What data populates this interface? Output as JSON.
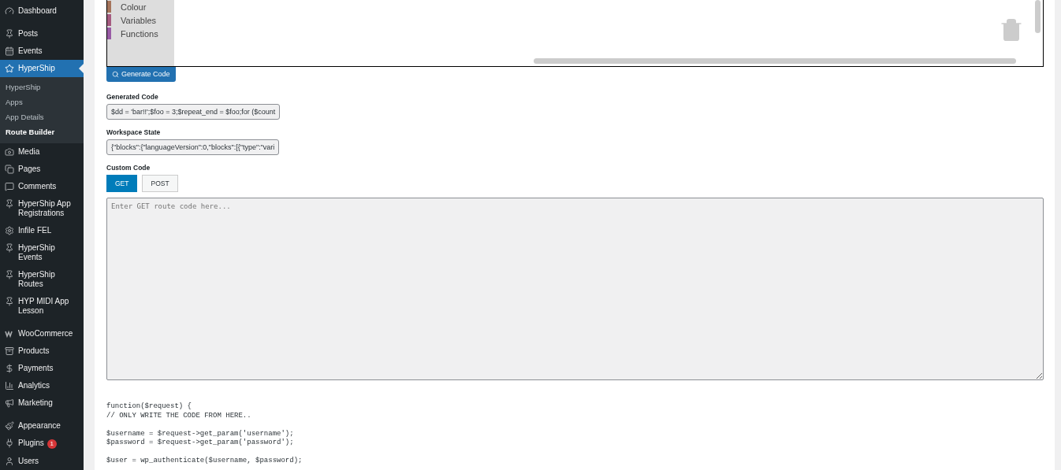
{
  "sidebar": {
    "groups": [
      {
        "items": [
          {
            "label": "Dashboard",
            "selected": false
          }
        ]
      },
      {
        "items": [
          {
            "label": "Posts",
            "selected": false
          },
          {
            "label": "Events",
            "selected": false
          },
          {
            "label": "HyperShip",
            "selected": true,
            "children": [
              {
                "label": "HyperShip",
                "selected": false
              },
              {
                "label": "Apps",
                "selected": false
              },
              {
                "label": "App Details",
                "selected": false
              },
              {
                "label": "Route Builder",
                "selected": true
              }
            ]
          },
          {
            "label": "Media",
            "selected": false
          },
          {
            "label": "Pages",
            "selected": false
          },
          {
            "label": "Comments",
            "selected": false
          },
          {
            "label": "HyperShip App Registrations",
            "selected": false
          },
          {
            "label": "Infile FEL",
            "selected": false
          },
          {
            "label": "HyperShip Events",
            "selected": false
          },
          {
            "label": "HyperShip Routes",
            "selected": false
          },
          {
            "label": "HYP MIDI App Lesson",
            "selected": false
          }
        ]
      },
      {
        "items": [
          {
            "label": "WooCommerce",
            "selected": false
          },
          {
            "label": "Products",
            "selected": false
          },
          {
            "label": "Payments",
            "selected": false
          },
          {
            "label": "Analytics",
            "selected": false
          },
          {
            "label": "Marketing",
            "selected": false
          }
        ]
      },
      {
        "items": [
          {
            "label": "Appearance",
            "selected": false
          },
          {
            "label": "Plugins",
            "selected": false,
            "badge": "1"
          },
          {
            "label": "Users",
            "selected": false
          }
        ]
      }
    ]
  },
  "workspace": {
    "categories": [
      {
        "label": "Colour",
        "color": "#a5745b"
      },
      {
        "label": "Variables",
        "color": "#a55b80"
      },
      {
        "label": "Functions",
        "color": "#995ba5"
      }
    ]
  },
  "generate_button": "Generate Code",
  "generated_code": {
    "label": "Generated Code",
    "value": "$dd = 'bar!!';$foo = 3;$repeat_end = $foo;for ($count"
  },
  "workspace_state": {
    "label": "Workspace State",
    "value": "{\"blocks\":{\"languageVersion\":0,\"blocks\":[{\"type\":\"vari"
  },
  "custom_code": {
    "label": "Custom Code",
    "tabs": [
      {
        "label": "GET",
        "selected": true
      },
      {
        "label": "POST",
        "selected": false
      }
    ],
    "placeholder": "Enter GET route code here..."
  },
  "code_blocks": [
    [
      "function($request) {",
      "// ONLY WRITE THE CODE FROM HERE.."
    ],
    [
      "$username = $request->get_param('username');",
      "$password = $request->get_param('password');"
    ],
    [
      "$user = wp_authenticate($username, $password);"
    ]
  ]
}
